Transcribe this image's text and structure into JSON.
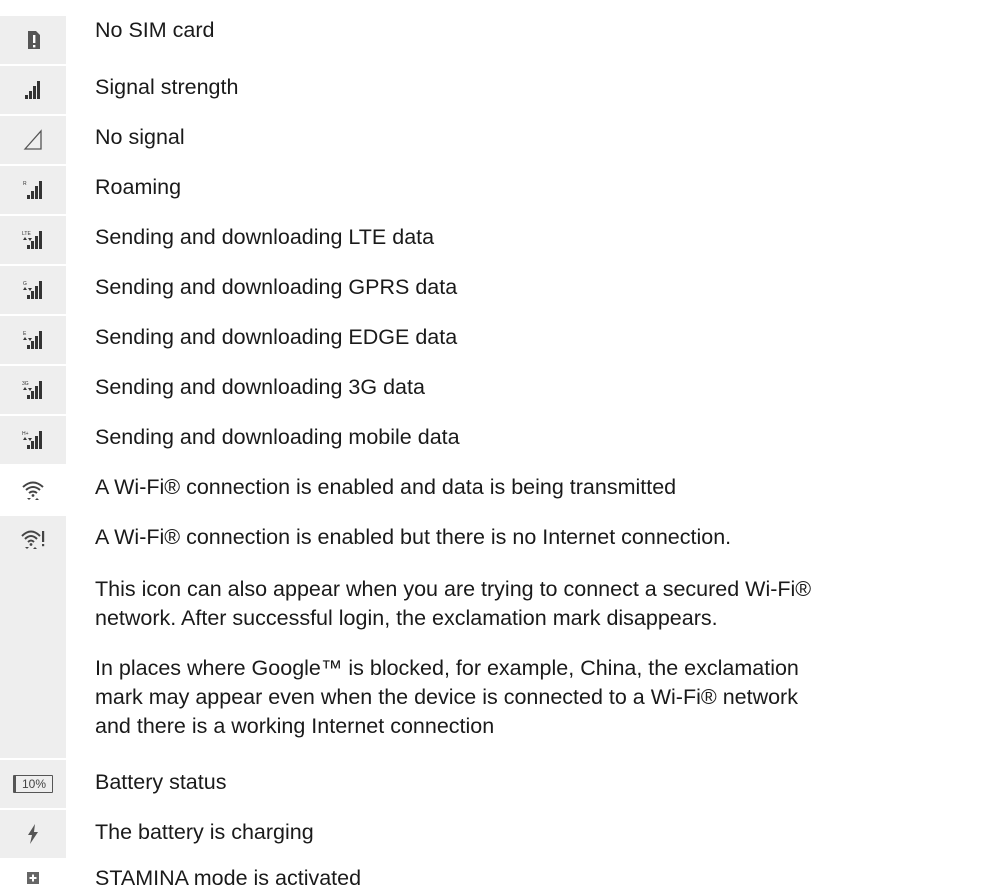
{
  "rows": [
    {
      "icon": "no-sim-icon",
      "label": "No SIM card"
    },
    {
      "icon": "signal-strength-icon",
      "label": "Signal strength"
    },
    {
      "icon": "no-signal-icon",
      "label": "No signal"
    },
    {
      "icon": "roaming-icon",
      "label": "Roaming"
    },
    {
      "icon": "lte-data-icon",
      "label": "Sending and downloading LTE data"
    },
    {
      "icon": "gprs-data-icon",
      "label": "Sending and downloading GPRS data"
    },
    {
      "icon": "edge-data-icon",
      "label": "Sending and downloading EDGE data"
    },
    {
      "icon": "3g-data-icon",
      "label": "Sending and downloading 3G data"
    },
    {
      "icon": "mobile-data-icon",
      "label": "Sending and downloading mobile data"
    },
    {
      "icon": "wifi-transmitting-icon",
      "label": "A Wi-Fi® connection is enabled and data is being transmitted"
    },
    {
      "icon": "wifi-no-internet-icon",
      "label": "A Wi-Fi® connection is enabled but there is no Internet connection.",
      "para1_line1": "This icon can also appear when you are trying to connect a secured Wi-Fi®",
      "para1_line2": "network. After successful login, the exclamation mark disappears.",
      "para2_line1": "In places where Google™ is blocked, for example, China, the exclamation",
      "para2_line2": "mark may appear even when the device is connected to a Wi-Fi® network",
      "para2_line3": "and there is a working Internet connection"
    },
    {
      "icon": "battery-status-icon",
      "label": "Battery status",
      "battery_text": "10%"
    },
    {
      "icon": "battery-charging-icon",
      "label": "The battery is charging"
    },
    {
      "icon": "stamina-mode-icon",
      "label": "STAMINA mode is activated"
    }
  ]
}
